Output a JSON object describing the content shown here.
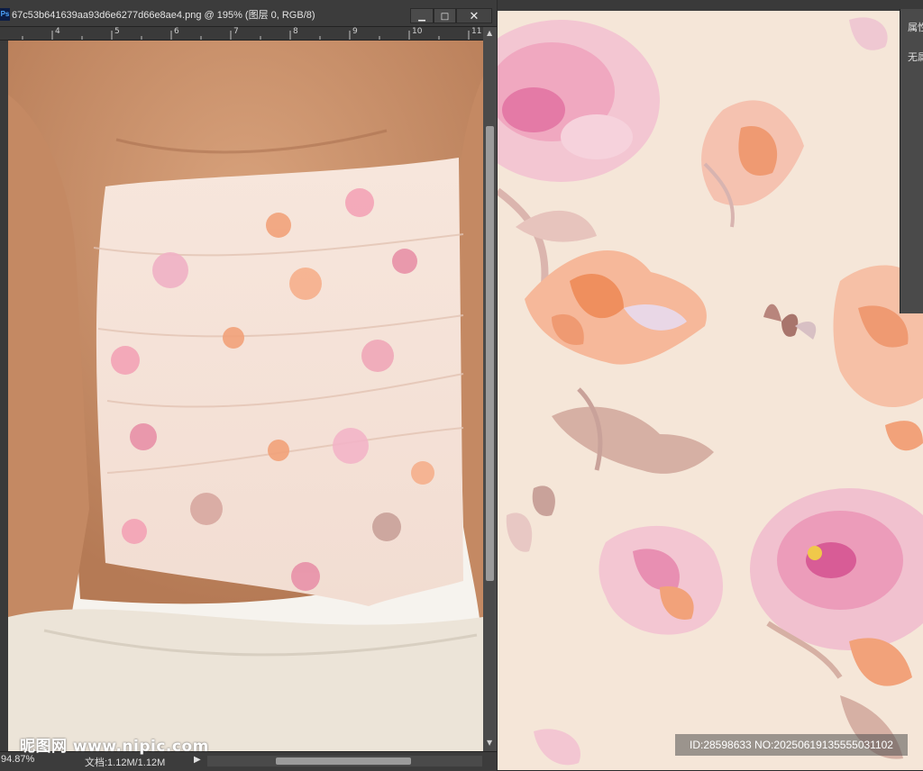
{
  "window": {
    "app_icon": "photoshop-icon",
    "title": "67c53b641639aa93d6e6277d66e8ae4.png @ 195% (图层 0, RGB/8)",
    "minimize": "▁",
    "maximize": "□",
    "close": "✕"
  },
  "ruler": {
    "labels": [
      "4",
      "5",
      "6",
      "7",
      "8",
      "9",
      "10",
      "11"
    ]
  },
  "status": {
    "zoom": "94.87%",
    "doc_size": "文档:1.12M/1.12M",
    "arrow": "▶"
  },
  "watermark": {
    "text": "昵图网 www.nipic.com",
    "id_text": "ID:28598633 NO:20250619135555031102"
  },
  "properties_panel": {
    "title": "属性",
    "value": "无属"
  },
  "colors": {
    "workspace": "#535353",
    "chrome": "#3c3c3c",
    "pattern_background": "#f5e6d8",
    "flower_pink": "#f0a8b8",
    "flower_orange": "#f2a27a",
    "leaf_mauve": "#c9a29a"
  }
}
